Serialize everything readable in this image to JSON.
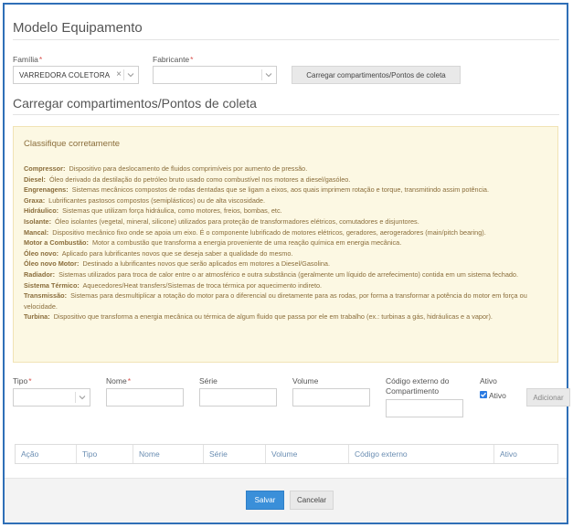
{
  "header": {
    "title": "Modelo Equipamento"
  },
  "form": {
    "familia": {
      "label": "Família",
      "required": "*",
      "value": "VARREDORA COLETORA",
      "clear": "×"
    },
    "fabricante": {
      "label": "Fabricante",
      "required": "*",
      "value": ""
    },
    "load_button": "Carregar compartimentos/Pontos de coleta"
  },
  "section": {
    "title": "Carregar compartimentos/Pontos de coleta"
  },
  "classify": {
    "title": "Classifique corretamente",
    "items": [
      {
        "term": "Compressor:",
        "desc": "Dispositivo para deslocamento de fluidos comprimíveis por aumento de pressão."
      },
      {
        "term": "Diesel:",
        "desc": "Óleo derivado da destilação do petróleo bruto usado como combustível nos motores a diesel/gasóleo."
      },
      {
        "term": "Engrenagens:",
        "desc": "Sistemas mecânicos compostos de rodas dentadas que se ligam a eixos, aos quais imprimem rotação e torque, transmitindo assim potência."
      },
      {
        "term": "Graxa:",
        "desc": "Lubrificantes pastosos compostos (semiplásticos) ou de alta viscosidade."
      },
      {
        "term": "Hidráulico:",
        "desc": "Sistemas que utilizam força hidráulica, como motores, freios, bombas, etc."
      },
      {
        "term": "Isolante:",
        "desc": "Óleo isolantes (vegetal, mineral, silicone) utilizados para proteção de transformadores elétricos, comutadores e disjuntores."
      },
      {
        "term": "Mancal:",
        "desc": "Dispositivo mecânico fixo onde se apoia um eixo. É o componente lubrificado de motores elétricos, geradores, aerogeradores (main/pitch bearing)."
      },
      {
        "term": "Motor a Combustão:",
        "desc": "Motor a combustão que transforma a energia proveniente de uma reação química em energia mecânica."
      },
      {
        "term": "Óleo novo:",
        "desc": "Aplicado para lubrificantes novos que se deseja saber a qualidade do mesmo."
      },
      {
        "term": "Óleo novo Motor:",
        "desc": "Destinado a lubrificantes novos que serão aplicados em motores a Diesel/Gasolina."
      },
      {
        "term": "Radiador:",
        "desc": "Sistemas utilizados para troca de calor entre o ar atmosférico e outra substância (geralmente um líquido de arrefecimento) contida em um sistema fechado."
      },
      {
        "term": "Sistema Térmico:",
        "desc": "Aquecedores/Heat transfers/Sistemas de troca térmica por aquecimento indireto."
      },
      {
        "term": "Transmissão:",
        "desc": "Sistemas para desmultiplicar a rotação do motor para o diferencial ou diretamente para as rodas, por forma a transformar a potência do motor em força ou velocidade."
      },
      {
        "term": "Turbina:",
        "desc": "Dispositivo que transforma a energia mecânica ou térmica de algum fluido que passa por ele em trabalho (ex.: turbinas a gás, hidráulicas e a vapor)."
      }
    ]
  },
  "compartment": {
    "tipo": {
      "label": "Tipo",
      "required": "*"
    },
    "nome": {
      "label": "Nome",
      "required": "*"
    },
    "serie": {
      "label": "Série"
    },
    "volume": {
      "label": "Volume"
    },
    "codigo_externo": {
      "label": "Código externo do Compartimento"
    },
    "ativo": {
      "label": "Ativo",
      "checkbox_label": "Ativo",
      "checked": true
    },
    "add_button": "Adicionar"
  },
  "table": {
    "columns": [
      "Ação",
      "Tipo",
      "Nome",
      "Série",
      "Volume",
      "Código externo",
      "Ativo"
    ]
  },
  "footer": {
    "save": "Salvar",
    "cancel": "Cancelar"
  },
  "colors": {
    "frame": "#2f6fb7",
    "primary": "#3a8fd9",
    "warning_bg": "#fcf8e3",
    "warning_text": "#8a6d3b",
    "header_link": "#6a8db2"
  }
}
